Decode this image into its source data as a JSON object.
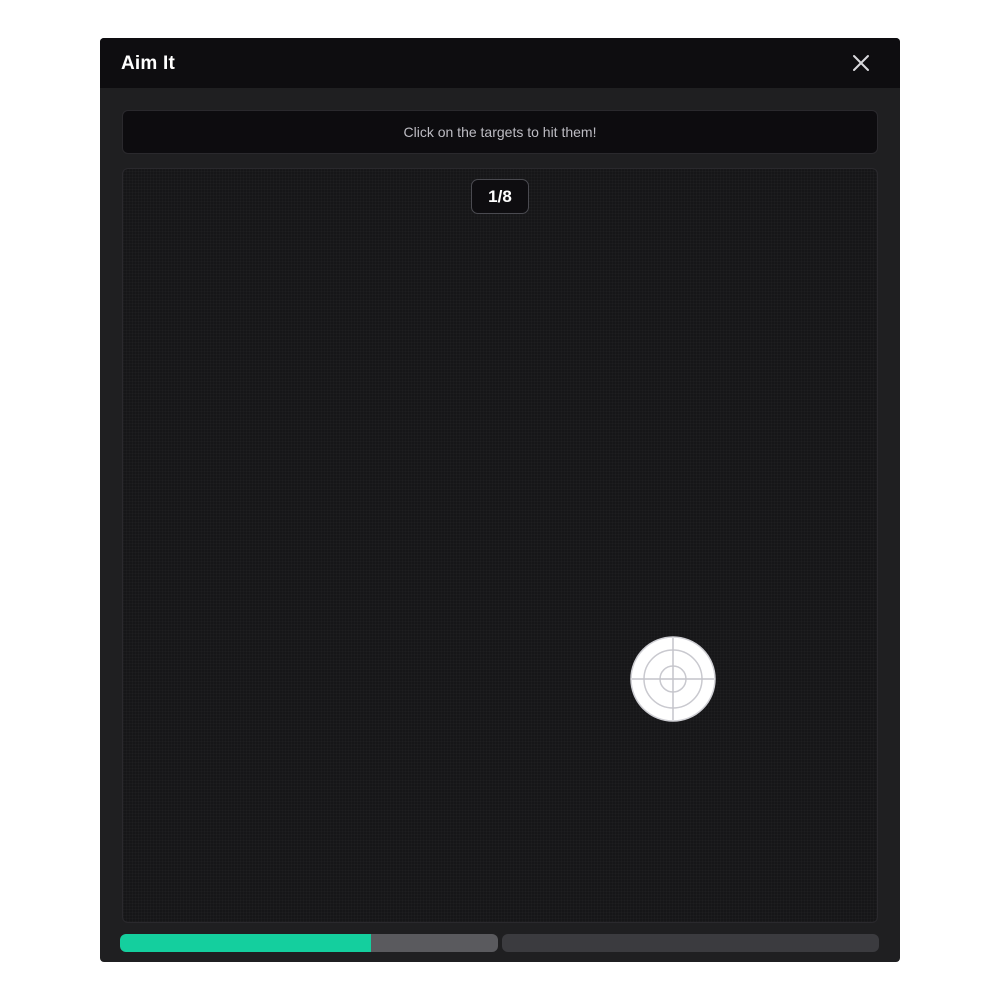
{
  "window": {
    "title": "Aim It"
  },
  "instruction": {
    "text": "Click on the targets to hit them!"
  },
  "counter": {
    "text": "1/8"
  },
  "progress": {
    "segments": [
      {
        "fill_fraction": 0.665,
        "color": "#14cf9e",
        "track_color": "#5a5a5e"
      },
      {
        "fill_fraction": 0.0,
        "color": "#14cf9e",
        "track_color": "#3b3b3f"
      }
    ]
  },
  "colors": {
    "accent": "#14cf9e",
    "titlebar": "#0e0d10",
    "window_bg": "#1f1f21",
    "arena_bg": "#161618"
  },
  "icons": {
    "close": "close-icon",
    "target": "target-icon"
  }
}
